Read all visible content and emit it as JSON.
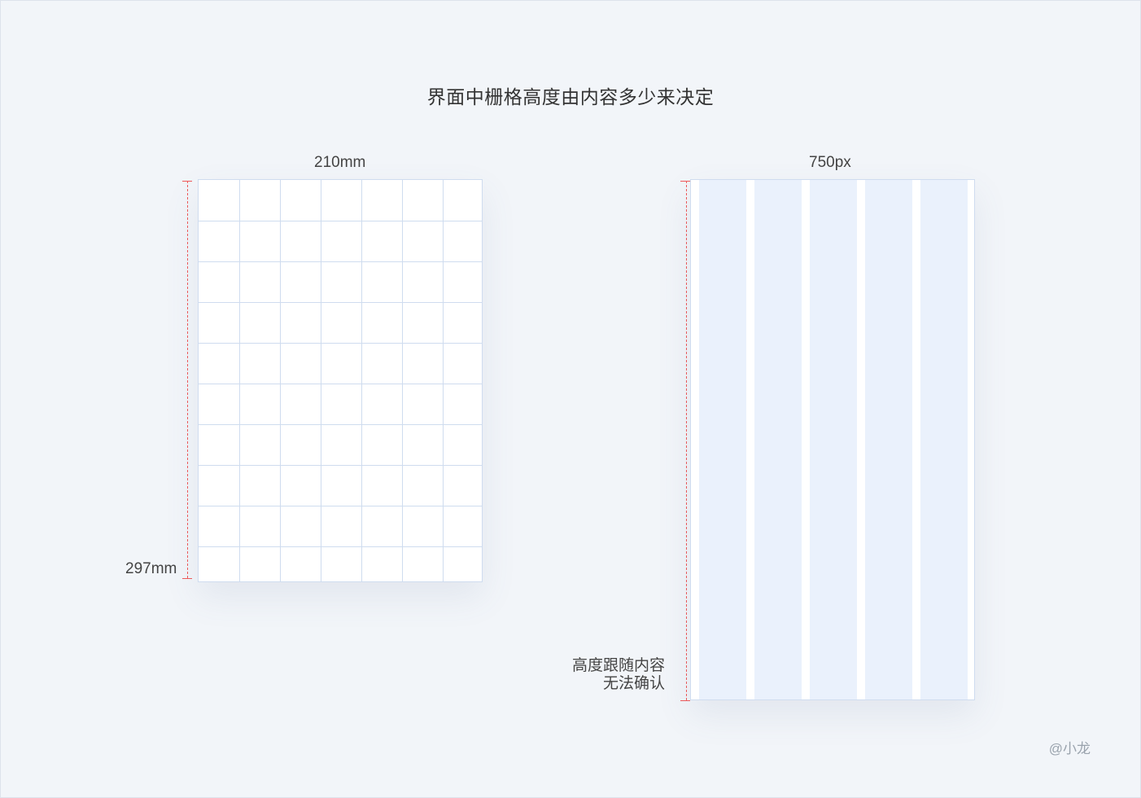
{
  "title": "界面中栅格高度由内容多少来决定",
  "left": {
    "width_label": "210mm",
    "height_label": "297mm",
    "grid": {
      "columns": 7,
      "rows": 10
    }
  },
  "right": {
    "width_label": "750px",
    "columns": 5,
    "note_line1": "高度跟随内容",
    "note_line2": "无法确认"
  },
  "credit": "@小龙",
  "colors": {
    "background": "#f2f5f9",
    "grid_line": "#cfdcef",
    "column_fill": "#eaf1fc",
    "dimension_line": "#f05a5a"
  }
}
